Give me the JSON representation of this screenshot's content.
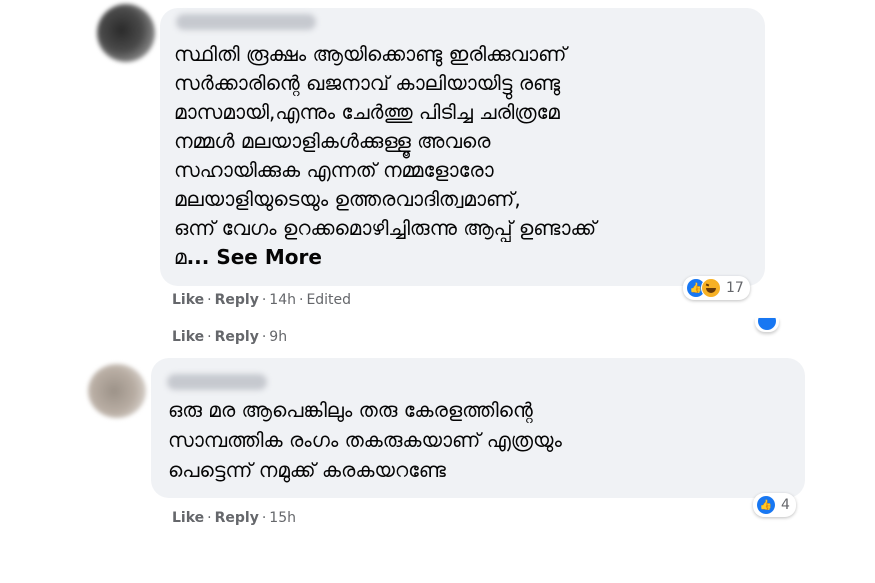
{
  "comments": [
    {
      "text": "സ്ഥിതി രൂക്ഷം ആയിക്കൊണ്ടു ഇരിക്കുവാണ്\nസർക്കാരിന്റെ ഖജനാവ് കാലിയായിട്ടു രണ്ടു\nമാസമായി,എന്നും ചേർത്തു പിടിച്ച ചരിത്രമേ\nനമ്മൾ മലയാളികൾക്കുള്ളൂ അവരെ\nസഹായിക്കുക എന്നത് നമ്മളോരോ\nമലയാളിയുടെയും ഉത്തരവാദിത്വമാണ്,\nഒന്ന് വേഗം ഉറക്കമൊഴിച്ചിരുന്നു ആപ്പ് ഉണ്ടാക്ക്\nമ",
      "see_more": "... See More",
      "like": "Like",
      "reply": "Reply",
      "time": "14h",
      "edited": "Edited",
      "reaction_count": "17"
    },
    {
      "text": "ഒരു മര ആപെങ്കിലും തരു കേരളത്തിന്റെ\nസാമ്പത്തിക രംഗം തകരുകയാണ് എത്രയും\nപെട്ടെന്ന് നമുക്ക് കരകയറണ്ടേ",
      "like": "Like",
      "reply": "Reply",
      "time": "15h",
      "reaction_count": "4"
    }
  ],
  "collapsed_reply": {
    "like": "Like",
    "reply": "Reply",
    "time": "9h"
  },
  "sep": "·",
  "icons": {
    "like": "thumbs-up-icon",
    "haha": "laughing-face-icon"
  },
  "colors": {
    "bubble": "#f0f2f5",
    "meta_text": "#65676b",
    "like_blue": "#1877f2",
    "haha_yellow": "#f7b125"
  }
}
